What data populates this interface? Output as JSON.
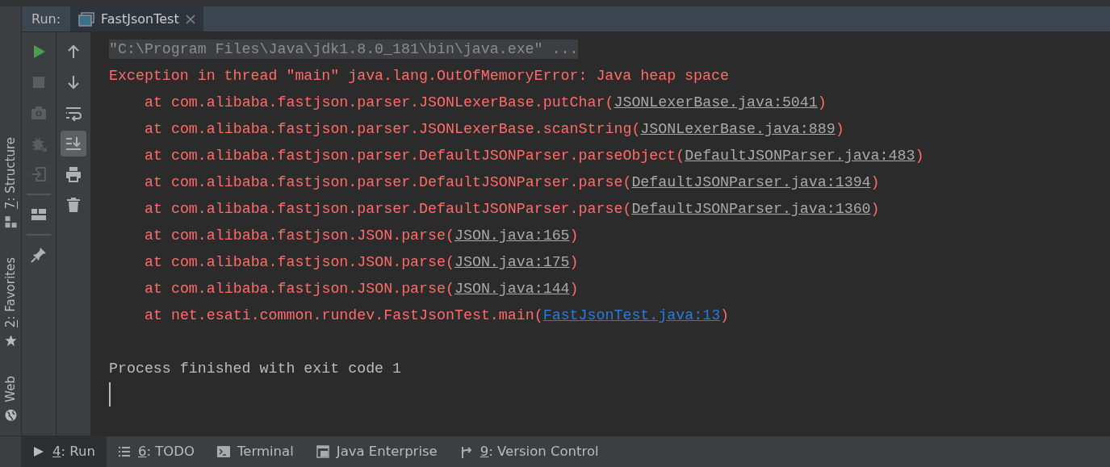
{
  "run_panel": {
    "label": "Run:",
    "tabs": [
      {
        "label": "FastJsonTest",
        "selected": true
      }
    ]
  },
  "side_tools": [
    {
      "key": "7",
      "label": ": Structure",
      "kind": "structure"
    },
    {
      "key": "2",
      "label": ": Favorites",
      "kind": "favorites"
    },
    {
      "label": "Web",
      "kind": "web"
    }
  ],
  "toolbar_primary": [
    {
      "kind": "run",
      "disabled": false
    },
    {
      "kind": "stop",
      "disabled": true
    },
    {
      "kind": "camera",
      "disabled": true
    },
    {
      "kind": "bug",
      "disabled": true
    },
    {
      "kind": "login",
      "disabled": true
    },
    {
      "kind": "separator"
    },
    {
      "kind": "layout",
      "disabled": false
    },
    {
      "kind": "separator"
    },
    {
      "kind": "pin",
      "disabled": false
    }
  ],
  "toolbar_secondary": [
    {
      "kind": "up",
      "on": false
    },
    {
      "kind": "down",
      "on": false
    },
    {
      "kind": "wrap",
      "on": false
    },
    {
      "kind": "scroll_end",
      "on": true
    },
    {
      "kind": "print",
      "on": false
    },
    {
      "kind": "trash",
      "on": false
    }
  ],
  "console": [
    {
      "kind": "command",
      "text": "\"C:\\Program Files\\Java\\jdk1.8.0_181\\bin\\java.exe\" ..."
    },
    {
      "kind": "error",
      "text": "Exception in thread \"main\" java.lang.OutOfMemoryError: Java heap space"
    },
    {
      "kind": "frame",
      "before": "at com.alibaba.fastjson.parser.JSONLexerBase.putChar(",
      "link": "JSONLexerBase.java:5041",
      "after": ")",
      "user_code": false
    },
    {
      "kind": "frame",
      "before": "at com.alibaba.fastjson.parser.JSONLexerBase.scanString(",
      "link": "JSONLexerBase.java:889",
      "after": ")",
      "user_code": false
    },
    {
      "kind": "frame",
      "before": "at com.alibaba.fastjson.parser.DefaultJSONParser.parseObject(",
      "link": "DefaultJSONParser.java:483",
      "after": ")",
      "user_code": false
    },
    {
      "kind": "frame",
      "before": "at com.alibaba.fastjson.parser.DefaultJSONParser.parse(",
      "link": "DefaultJSONParser.java:1394",
      "after": ")",
      "user_code": false
    },
    {
      "kind": "frame",
      "before": "at com.alibaba.fastjson.parser.DefaultJSONParser.parse(",
      "link": "DefaultJSONParser.java:1360",
      "after": ")",
      "user_code": false
    },
    {
      "kind": "frame",
      "before": "at com.alibaba.fastjson.JSON.parse(",
      "link": "JSON.java:165",
      "after": ")",
      "user_code": false
    },
    {
      "kind": "frame",
      "before": "at com.alibaba.fastjson.JSON.parse(",
      "link": "JSON.java:175",
      "after": ")",
      "user_code": false
    },
    {
      "kind": "frame",
      "before": "at com.alibaba.fastjson.JSON.parse(",
      "link": "JSON.java:144",
      "after": ")",
      "user_code": false
    },
    {
      "kind": "frame",
      "before": "at net.esati.common.rundev.FastJsonTest.main(",
      "link": "FastJsonTest.java:13",
      "after": ")",
      "user_code": true
    },
    {
      "kind": "blank"
    },
    {
      "kind": "info",
      "text": "Process finished with exit code 1"
    },
    {
      "kind": "cursor"
    }
  ],
  "bottom_tabs": [
    {
      "key": "4",
      "label": ": Run",
      "kind": "run",
      "selected": true
    },
    {
      "key": "6",
      "label": ": TODO",
      "kind": "todo",
      "selected": false
    },
    {
      "label": "Terminal",
      "kind": "terminal",
      "selected": false
    },
    {
      "label": "Java Enterprise",
      "kind": "enterprise",
      "selected": false
    },
    {
      "key": "9",
      "label": ": Version Control",
      "kind": "vcs",
      "selected": false
    }
  ]
}
